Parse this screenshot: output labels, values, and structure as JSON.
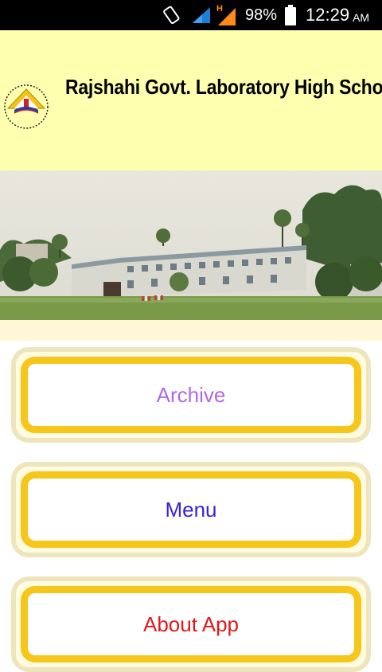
{
  "status_bar": {
    "battery_percent": "98%",
    "time": "12:29",
    "ampm": "AM",
    "network_label": "H",
    "icons": [
      "rotate-icon",
      "signal-icon",
      "h-signal-icon",
      "battery-icon"
    ]
  },
  "header": {
    "school_name": "Rajshahi Govt. Laboratory High School",
    "background_color": "#ffffb0"
  },
  "photo": {
    "description_icon": "school-building-photo"
  },
  "buttons": [
    {
      "label": "Archive",
      "color": "#b068e6"
    },
    {
      "label": "Menu",
      "color": "#3a22d9"
    },
    {
      "label": "About App",
      "color": "#e01818"
    }
  ],
  "colors": {
    "button_border": "#f7c61a",
    "button_outer": "#ede6bd"
  }
}
